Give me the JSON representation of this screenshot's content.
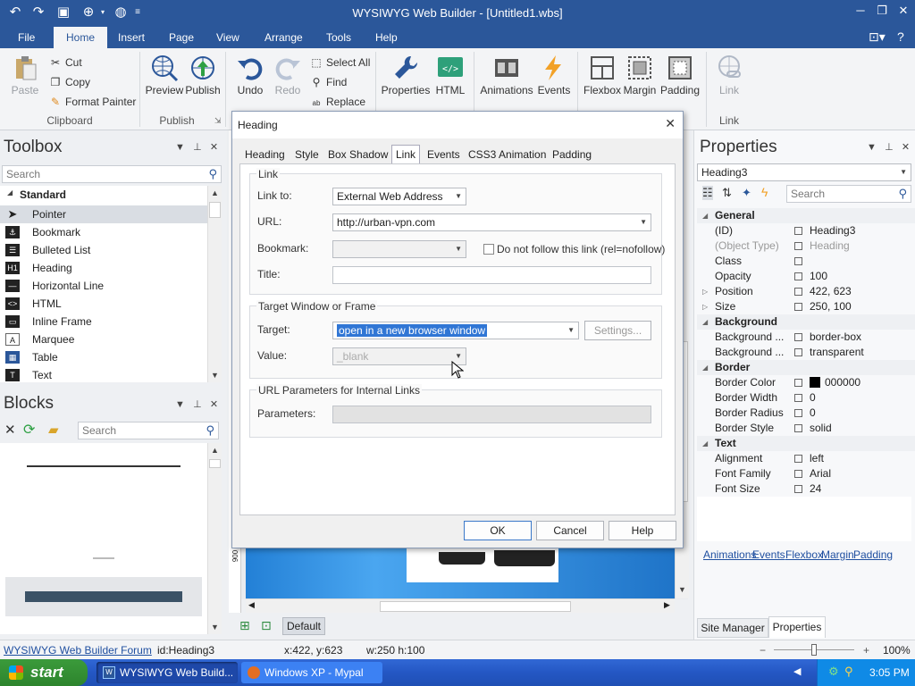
{
  "window": {
    "title": "WYSIWYG Web Builder - [Untitled1.wbs]"
  },
  "menu_tabs": [
    "File",
    "Home",
    "Insert",
    "Page",
    "View",
    "Arrange",
    "Tools",
    "Help"
  ],
  "ribbon": {
    "paste": "Paste",
    "cut": "Cut",
    "copy": "Copy",
    "format_painter": "Format Painter",
    "clipboard": "Clipboard",
    "preview": "Preview",
    "publish": "Publish",
    "publish_group": "Publish",
    "undo": "Undo",
    "redo": "Redo",
    "select_all": "Select All",
    "find": "Find",
    "replace": "Replace",
    "properties": "Properties",
    "html": "HTML",
    "animations": "Animations",
    "events": "Events",
    "flexbox": "Flexbox",
    "margin": "Margin",
    "padding": "Padding",
    "link": "Link",
    "link_group": "Link"
  },
  "toolbox": {
    "title": "Toolbox",
    "search_placeholder": "Search",
    "category": "Standard",
    "items": [
      "Pointer",
      "Bookmark",
      "Bulleted List",
      "Heading",
      "Horizontal Line",
      "HTML",
      "Inline Frame",
      "Marquee",
      "Table",
      "Text"
    ]
  },
  "blocks": {
    "title": "Blocks",
    "search_placeholder": "Search"
  },
  "dialog": {
    "title": "Heading",
    "tabs": [
      "Heading",
      "Style",
      "Box Shadow",
      "Link",
      "Events",
      "CSS3 Animation",
      "Padding"
    ],
    "link_group": "Link",
    "link_to_label": "Link to:",
    "link_to_value": "External Web Address",
    "url_label": "URL:",
    "url_value": "http://urban-vpn.com",
    "bookmark_label": "Bookmark:",
    "nofollow_label": "Do not follow this link (rel=nofollow)",
    "title_label": "Title:",
    "target_group": "Target Window or Frame",
    "target_label": "Target:",
    "target_value": "open in a new browser window",
    "settings_button": "Settings...",
    "value_label": "Value:",
    "value_value": "_blank",
    "params_group": "URL Parameters for Internal Links",
    "params_label": "Parameters:",
    "ok": "OK",
    "cancel": "Cancel",
    "help": "Help"
  },
  "canvas": {
    "ruler_label": "900",
    "page_tab": "Default"
  },
  "properties": {
    "title": "Properties",
    "object": "Heading3",
    "search_placeholder": "Search",
    "rows": [
      {
        "k": "General",
        "cat": true
      },
      {
        "k": "(ID)",
        "v": "Heading3"
      },
      {
        "k": "(Object Type)",
        "v": "Heading",
        "dim": true
      },
      {
        "k": "Class",
        "v": ""
      },
      {
        "k": "Opacity",
        "v": "100"
      },
      {
        "k": "Position",
        "v": "422, 623",
        "exp": true
      },
      {
        "k": "Size",
        "v": "250, 100",
        "exp": true
      },
      {
        "k": "Background",
        "cat": true
      },
      {
        "k": "Background ...",
        "v": "border-box"
      },
      {
        "k": "Background ...",
        "v": "transparent"
      },
      {
        "k": "Border",
        "cat": true
      },
      {
        "k": "Border Color",
        "v": "000000",
        "swatch": true
      },
      {
        "k": "Border Width",
        "v": "0"
      },
      {
        "k": "Border Radius",
        "v": "0"
      },
      {
        "k": "Border Style",
        "v": "solid"
      },
      {
        "k": "Text",
        "cat": true
      },
      {
        "k": "Alignment",
        "v": "left"
      },
      {
        "k": "Font Family",
        "v": "Arial"
      },
      {
        "k": "Font Size",
        "v": "24"
      }
    ],
    "links": [
      "Animations",
      "Events",
      "Flexbox",
      "Margin",
      "Padding"
    ],
    "tab_site_manager": "Site Manager",
    "tab_properties": "Properties"
  },
  "status": {
    "forum_link": "WYSIWYG Web Builder Forum",
    "id": "id:Heading3",
    "xy": "x:422, y:623",
    "wh": "w:250 h:100",
    "zoom_minus": "−",
    "zoom_plus": "+",
    "zoom": "100%"
  },
  "taskbar": {
    "start": "start",
    "item1": "WYSIWYG Web Build...",
    "item2": "Windows XP - Mypal",
    "clock": "3:05 PM"
  },
  "colors": {
    "accent": "#2b579a",
    "selection": "#3076d5"
  }
}
